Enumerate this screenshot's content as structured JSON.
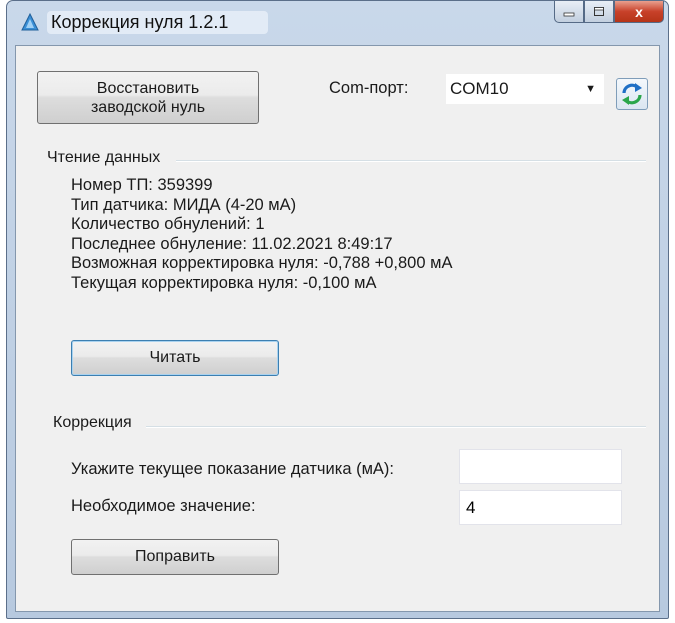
{
  "window": {
    "title": "Коррекция нуля 1.2.1",
    "caption_buttons": {
      "close": "x"
    }
  },
  "toolbar": {
    "restore_label_line1": "Восстановить",
    "restore_label_line2": "заводской нуль",
    "com_port_label": "Com-порт:",
    "com_port_value": "COM10",
    "refresh_icon": "refresh-icon"
  },
  "reading": {
    "group_title": "Чтение данных",
    "lines": [
      "Номер ТП: 359399",
      "Тип датчика: МИДА (4-20 мА)",
      "Количество обнулений: 1",
      "Последнее обнуление: 11.02.2021 8:49:17",
      "Возможная корректировка нуля: -0,788 +0,800 мА",
      "Текущая корректировка нуля: -0,100 мА"
    ],
    "read_button": "Читать"
  },
  "correction": {
    "group_title": "Коррекция",
    "current_reading_label": "Укажите текущее показание датчика (мА):",
    "current_reading_value": "",
    "required_value_label": "Необходимое значение:",
    "required_value_value": "4",
    "fix_button": "Поправить"
  },
  "colors": {
    "accent_border": "#3c7fb1",
    "close_button": "#c8412a",
    "refresh_arrow_blue": "#1f6fc5",
    "refresh_arrow_green": "#2aa64a"
  }
}
